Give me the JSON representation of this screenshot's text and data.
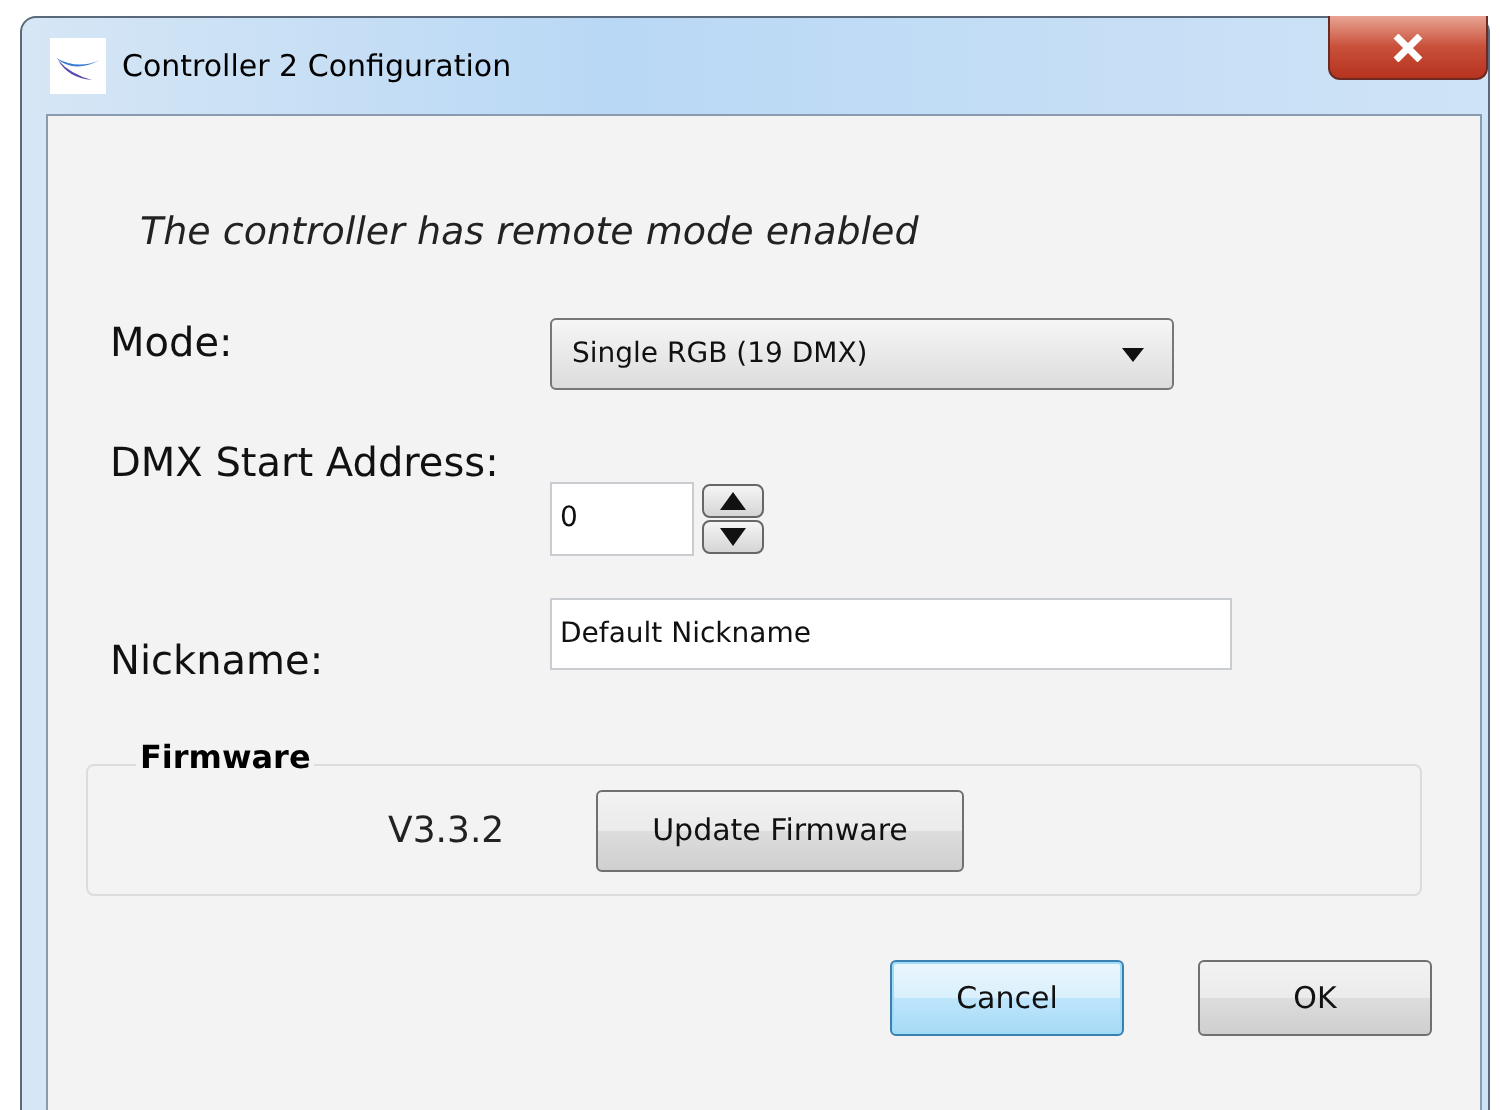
{
  "window": {
    "title": "Controller 2 Configuration"
  },
  "message": "The controller has remote mode enabled",
  "fields": [
    {
      "kind": "dropdown",
      "label": "Mode:",
      "value": "Single RGB (19 DMX)"
    },
    {
      "kind": "spinner",
      "label": "DMX Start Address:",
      "value": "0"
    },
    {
      "kind": "text",
      "label": "Nickname:",
      "value": "Default Nickname"
    }
  ],
  "firmware": {
    "title": "Firmware",
    "version": "V3.3.2",
    "button": "Update Firmware"
  },
  "buttons": [
    {
      "label": "Cancel",
      "focused": true
    },
    {
      "label": "OK",
      "focused": false
    }
  ]
}
